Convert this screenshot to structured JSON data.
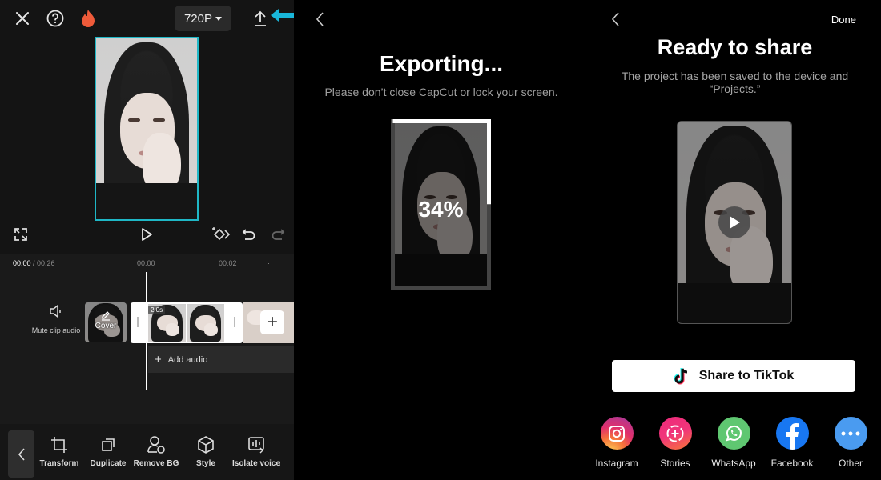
{
  "editor": {
    "resolution": "720P",
    "time_current": "00:00",
    "time_total": " / 00:26",
    "ruler_ticks": [
      "00:00",
      "00:02"
    ],
    "mute_label": "Mute clip audio",
    "cover_label": "Cover",
    "clip_duration": "2.0s",
    "add_audio_label": "Add audio",
    "tools": [
      {
        "icon": "crop-icon",
        "label": "Transform"
      },
      {
        "icon": "duplicate-icon",
        "label": "Duplicate"
      },
      {
        "icon": "remove-bg-icon",
        "label": "Remove BG"
      },
      {
        "icon": "cube-icon",
        "label": "Style"
      },
      {
        "icon": "isolate-voice-icon",
        "label": "Isolate voice"
      }
    ],
    "accent_color": "#1fb7c6"
  },
  "exporting": {
    "title": "Exporting...",
    "subtitle": "Please don’t close CapCut or lock your screen.",
    "progress_label": "34%",
    "progress_fraction": 0.34
  },
  "ready": {
    "done_label": "Done",
    "title": "Ready to share",
    "subtitle": "The project has been saved to the device and “Projects.”",
    "tiktok_label": "Share to TikTok",
    "share_targets": [
      {
        "icon": "instagram-icon",
        "label": "Instagram",
        "color": "#e1306c"
      },
      {
        "icon": "stories-icon",
        "label": "Stories",
        "color": "#f0357a"
      },
      {
        "icon": "whatsapp-icon",
        "label": "WhatsApp",
        "color": "#5fc771"
      },
      {
        "icon": "facebook-icon",
        "label": "Facebook",
        "color": "#1877f2"
      },
      {
        "icon": "more-icon",
        "label": "Other",
        "color": "#4a9bf0"
      }
    ]
  }
}
